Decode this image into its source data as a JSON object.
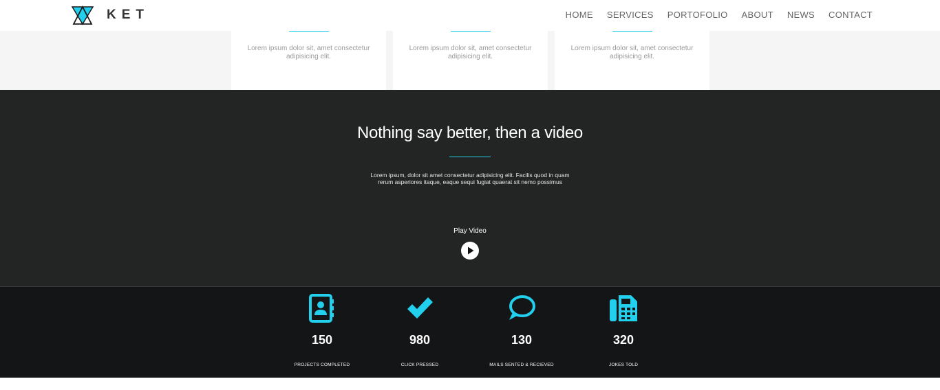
{
  "header": {
    "brand": "KET",
    "nav": [
      {
        "label": "HOME"
      },
      {
        "label": "SERVICES"
      },
      {
        "label": "PORTOFOLIO"
      },
      {
        "label": "ABOUT"
      },
      {
        "label": "NEWS"
      },
      {
        "label": "CONTACT"
      }
    ]
  },
  "services": {
    "cards": [
      {
        "text": "Lorem ipsum dolor sit, amet consectetur adipisicing elit."
      },
      {
        "text": "Lorem ipsum dolor sit, amet consectetur adipisicing elit."
      },
      {
        "text": "Lorem ipsum dolor sit, amet consectetur adipisicing elit."
      }
    ]
  },
  "video": {
    "title": "Nothing say better, then a video",
    "description": "Lorem ipsum, dolor sit amet consectetur adipisicing elit. Facilis quod in quam rerum asperiores itaque, eaque sequi fugiat quaerat sit nemo possimus",
    "play_label": "Play Video"
  },
  "stats": [
    {
      "icon": "contact-book-icon",
      "value": "150",
      "label": "PROJECTS COMPLETED"
    },
    {
      "icon": "checkmark-icon",
      "value": "980",
      "label": "CLICK PRESSED"
    },
    {
      "icon": "chat-bubble-icon",
      "value": "130",
      "label": "MAILS SENTED & RECIEVED"
    },
    {
      "icon": "fax-icon",
      "value": "320",
      "label": "JOKES TOLD"
    }
  ],
  "colors": {
    "accent": "#22d0ee",
    "dark_section": "#232525",
    "stats_section": "#141517",
    "light_section": "#f5f5f5"
  }
}
